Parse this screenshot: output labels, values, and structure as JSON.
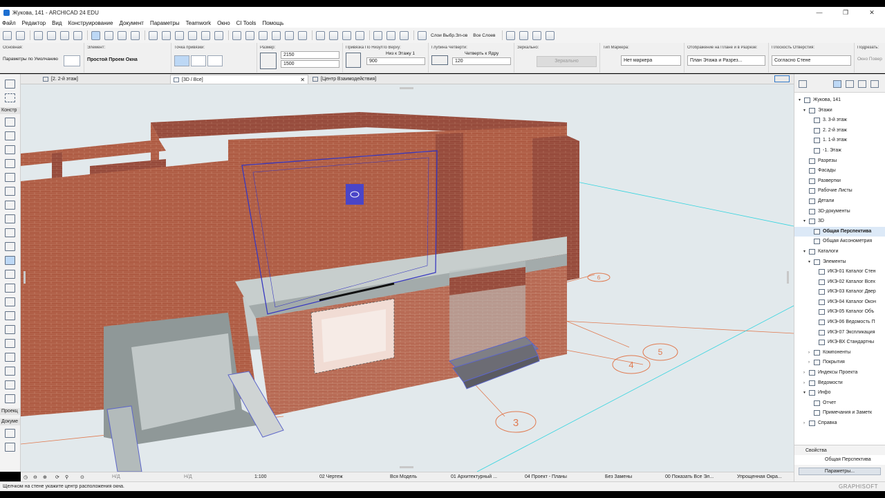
{
  "window": {
    "title": "Жукова, 141 - ARCHICAD 24 EDU",
    "controls": [
      "—",
      "❐",
      "✕"
    ]
  },
  "menu": [
    "Файл",
    "Редактор",
    "Вид",
    "Конструирование",
    "Документ",
    "Параметры",
    "Teamwork",
    "Окно",
    "CI Tools",
    "Помощь"
  ],
  "infobox": {
    "osnovnaya": {
      "label": "Основная:",
      "value": "Параметры по Умолчанию"
    },
    "element": {
      "label": "Элемент:",
      "value": "Простой Проем Окна"
    },
    "tochka": {
      "label": "Точка привязки:"
    },
    "razmer": {
      "label": "Размер:",
      "width": "2150",
      "height": "1500"
    },
    "privyazka": {
      "label": "Привязка По Низу/По Верху:",
      "mode": "Низ к Этажу 1",
      "value": "900"
    },
    "glubina": {
      "label": "Глубина Четверти:",
      "mode": "Четверть к Ядру",
      "value": "120"
    },
    "zerkalno": {
      "label": "Зеркально:",
      "value": "Зеркально"
    },
    "marker": {
      "label": "Тип Маркера:",
      "value": "Нет маркера"
    },
    "otobrazhenie": {
      "label": "Отображение на Плане и в Разрезе:",
      "value": "План Этажа и Разрез..."
    },
    "ploskost": {
      "label": "Плоскость Отверстия:",
      "value": "Согласно Стене"
    },
    "podrezat": {
      "label": "Подрезать:",
      "value": "Окно Поверх"
    }
  },
  "toolbar": {
    "layers_label": "Слои Выбр.Эл-ов",
    "all_layers_label": "Все Слоев"
  },
  "tabs": [
    {
      "label": "[2. 2-й этаж]"
    },
    {
      "label": "[3D / Все]",
      "close": "✕"
    },
    {
      "label": "[Центр Взаимодействия]"
    }
  ],
  "toolbox": {
    "section1": "Констр",
    "section2": "Проекц",
    "section3": "Докуме"
  },
  "viewport": {
    "grid_markers": [
      "6",
      "5",
      "4",
      "3"
    ]
  },
  "bottombar": {
    "nd1": "Н/Д",
    "nd2": "Н/Д",
    "scale": "1:100",
    "layers": "02 Чертеж",
    "model": "Вся Модель",
    "pen": "01 Архитектурный ...",
    "graphic": "04 Проект - Планы",
    "override": "Без Замены",
    "renovation": "00 Показать Все Эл...",
    "structure": "Упрощенная Окра..."
  },
  "status": {
    "message": "Щелчком на стене укажите центр расположения окна.",
    "brand": "GRAPHISOFT"
  },
  "navigator": {
    "items": [
      {
        "label": "Жукова, 141",
        "level": 0,
        "arrow": "▾"
      },
      {
        "label": "Этажи",
        "level": 1,
        "arrow": "▾"
      },
      {
        "label": "3. 3-й этаж",
        "level": 2,
        "arrow": ""
      },
      {
        "label": "2. 2-й этаж",
        "level": 2,
        "arrow": ""
      },
      {
        "label": "1. 1-й этаж",
        "level": 2,
        "arrow": ""
      },
      {
        "label": "-1. Этаж",
        "level": 2,
        "arrow": ""
      },
      {
        "label": "Разрезы",
        "level": 1,
        "arrow": ""
      },
      {
        "label": "Фасады",
        "level": 1,
        "arrow": ""
      },
      {
        "label": "Развертки",
        "level": 1,
        "arrow": ""
      },
      {
        "label": "Рабочие Листы",
        "level": 1,
        "arrow": ""
      },
      {
        "label": "Детали",
        "level": 1,
        "arrow": ""
      },
      {
        "label": "3D-документы",
        "level": 1,
        "arrow": ""
      },
      {
        "label": "3D",
        "level": 1,
        "arrow": "▾"
      },
      {
        "label": "Общая Перспектива",
        "level": 2,
        "arrow": "",
        "selected": true
      },
      {
        "label": "Общая Аксонометрия",
        "level": 2,
        "arrow": ""
      },
      {
        "label": "Каталоги",
        "level": 1,
        "arrow": "▾"
      },
      {
        "label": "Элементы",
        "level": 2,
        "arrow": "▾"
      },
      {
        "label": "ИКЭ-01 Каталог Стен",
        "level": 3,
        "arrow": ""
      },
      {
        "label": "ИКЭ-02 Каталог Всех",
        "level": 3,
        "arrow": ""
      },
      {
        "label": "ИКЭ-03 Каталог Двер",
        "level": 3,
        "arrow": ""
      },
      {
        "label": "ИКЭ-04 Каталог Окон",
        "level": 3,
        "arrow": ""
      },
      {
        "label": "ИКЭ-05 Каталог Объ",
        "level": 3,
        "arrow": ""
      },
      {
        "label": "ИКЭ-06 Ведомость П",
        "level": 3,
        "arrow": ""
      },
      {
        "label": "ИКЭ-07 Экспликация",
        "level": 3,
        "arrow": ""
      },
      {
        "label": "ИКЭ-ВХ Стандартны",
        "level": 3,
        "arrow": ""
      },
      {
        "label": "Компоненты",
        "level": 2,
        "arrow": "›"
      },
      {
        "label": "Покрытия",
        "level": 2,
        "arrow": "›"
      },
      {
        "label": "Индексы Проекта",
        "level": 1,
        "arrow": "›"
      },
      {
        "label": "Ведомости",
        "level": 1,
        "arrow": "›"
      },
      {
        "label": "Инфо",
        "level": 1,
        "arrow": "▾"
      },
      {
        "label": "Отчет",
        "level": 2,
        "arrow": ""
      },
      {
        "label": "Примечания и Заметк",
        "level": 2,
        "arrow": ""
      },
      {
        "label": "Справка",
        "level": 1,
        "arrow": "›"
      }
    ]
  },
  "properties": {
    "header": "Свойства",
    "value": "Общая Перспектива",
    "button": "Параметры..."
  }
}
